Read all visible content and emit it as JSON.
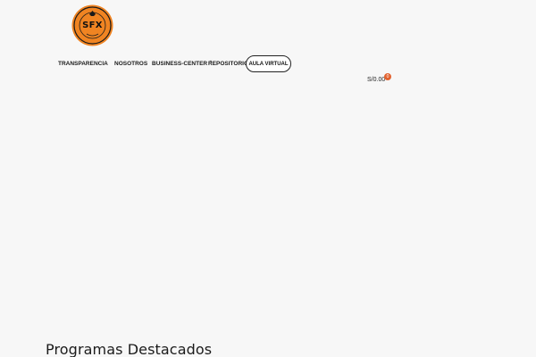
{
  "logo": {
    "text": "SFX",
    "ring_top": "BUSINESS SCHOOL",
    "ring_bottom": "PERÚ",
    "accent": "#f08422",
    "ring_color": "#1a1a1a"
  },
  "nav": {
    "items": [
      {
        "label": "TRANSPARENCIA",
        "has_dropdown": false
      },
      {
        "label": "NOSOTROS",
        "has_dropdown": false
      },
      {
        "label": "BUSINESS-CENTER",
        "has_dropdown": true
      },
      {
        "label": "REPOSITORIO",
        "has_dropdown": false
      }
    ],
    "cta_label": "AULA VIRTUAL"
  },
  "cart": {
    "total": "S/0.00",
    "count": "0",
    "badge_color": "#e2622f"
  },
  "section": {
    "title": "Programas Destacados"
  }
}
